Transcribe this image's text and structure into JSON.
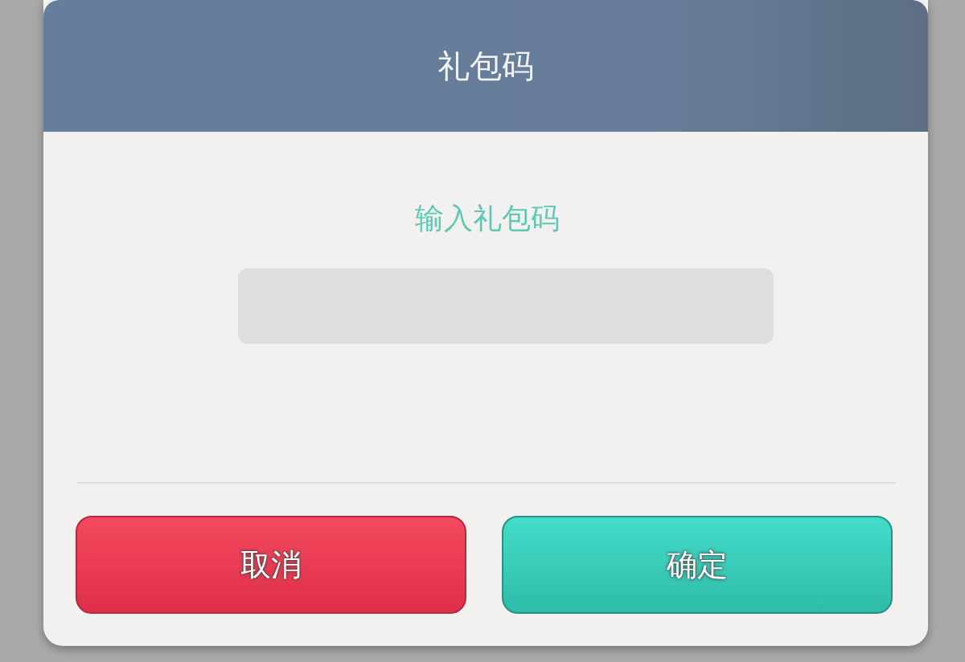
{
  "dialog": {
    "title": "礼包码",
    "prompt": "输入礼包码",
    "buttons": [
      {
        "label": "取消",
        "kind": "cancel"
      },
      {
        "label": "确定",
        "kind": "confirm"
      }
    ]
  }
}
